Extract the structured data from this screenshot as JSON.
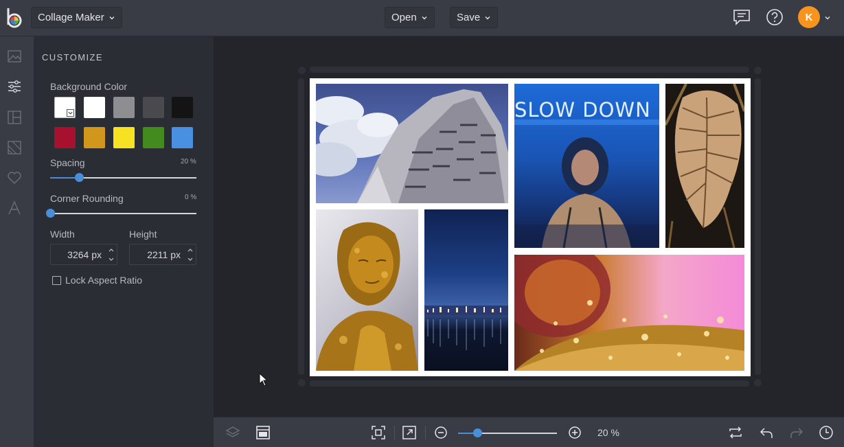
{
  "header": {
    "app_title": "Collage Maker",
    "open_label": "Open",
    "save_label": "Save",
    "avatar_initial": "K",
    "avatar_color": "#f7941d"
  },
  "rail": {
    "items": [
      "image-icon",
      "sliders-icon",
      "layout-icon",
      "background-icon",
      "heart-icon",
      "text-icon"
    ]
  },
  "customize": {
    "title": "CUSTOMIZE",
    "background_color_label": "Background Color",
    "swatches": [
      "#ffffff",
      "#ffffff",
      "#8e8e92",
      "#4a494e",
      "#141414",
      "#a8112d",
      "#d2961d",
      "#f6e123",
      "#438a1f",
      "#4a90e2"
    ],
    "spacing_label": "Spacing",
    "spacing_value": "20 %",
    "spacing_fraction": 0.2,
    "corner_label": "Corner Rounding",
    "corner_value": "0 %",
    "corner_fraction": 0,
    "width_label": "Width",
    "width_value": "3264",
    "height_label": "Height",
    "height_value": "2211",
    "unit": "px",
    "lock_label": "Lock Aspect Ratio",
    "lock_checked": false
  },
  "toolbar": {
    "zoom_value": "20 %",
    "zoom_fraction": 0.2
  }
}
